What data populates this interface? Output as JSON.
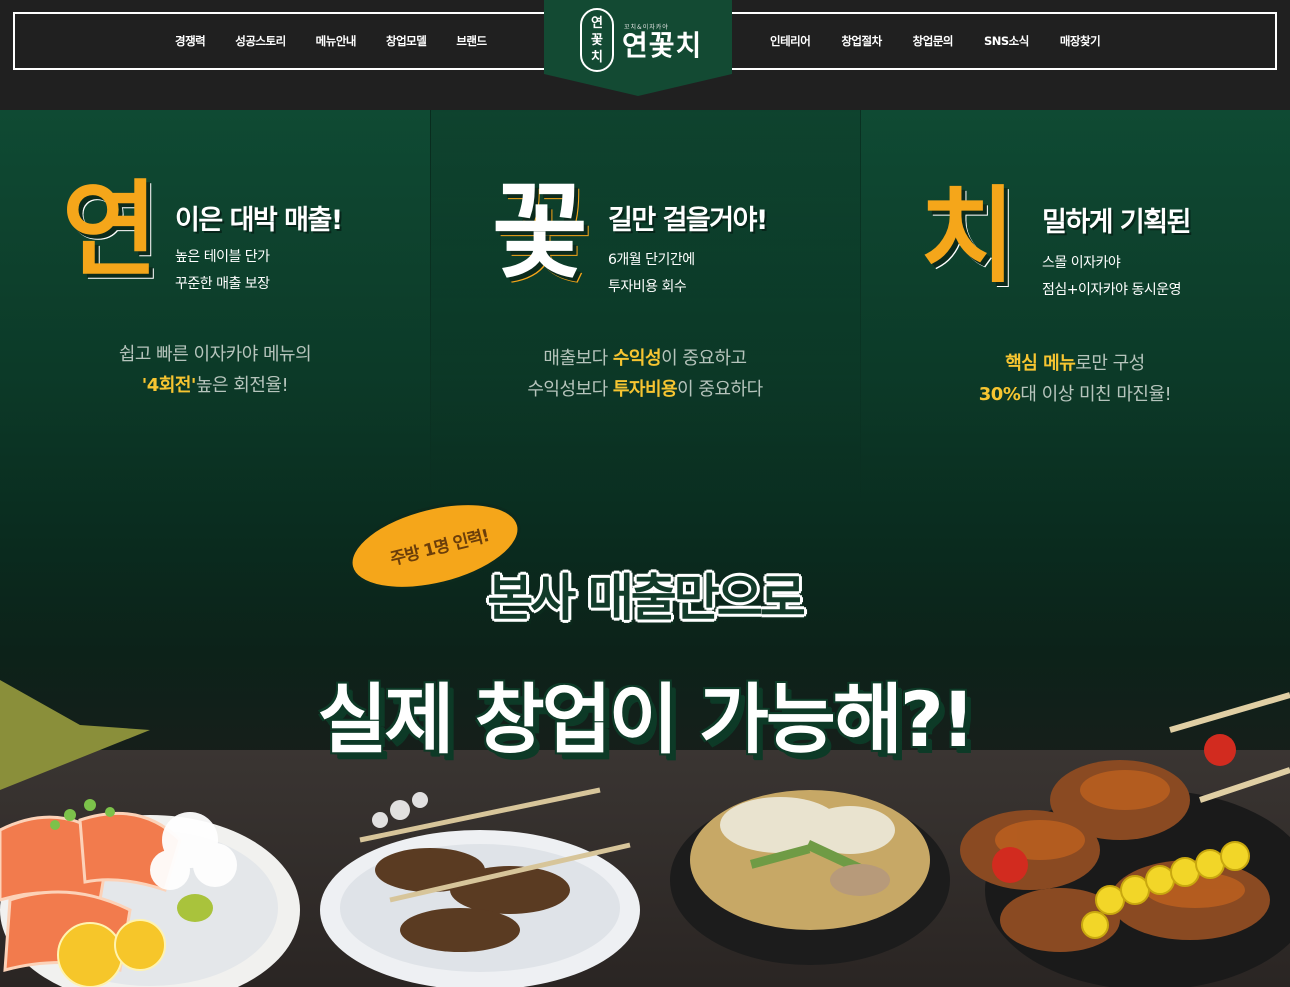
{
  "header": {
    "nav_left": [
      "경쟁력",
      "성공스토리",
      "메뉴안내",
      "창업모델",
      "브랜드"
    ],
    "nav_right": [
      "인테리어",
      "창업절차",
      "창업문의",
      "SNS소식",
      "매장찾기"
    ],
    "logo": {
      "mark": [
        "연",
        "꽃",
        "치"
      ],
      "subtitle": "꼬치&이자카야",
      "text": "연꽃치"
    }
  },
  "columns": [
    {
      "big_char": "연",
      "headline": "이은 대박 매출!",
      "sub": [
        "높은 테이블 단가",
        "꾸준한 매출 보장"
      ],
      "desc_line1": "쉽고 빠른 이자카야 메뉴의",
      "desc_line2_hl": "'4회전'",
      "desc_line2_rest": "높은 회전율!"
    },
    {
      "big_char": "꽃",
      "headline": "길만 걸을거야!",
      "sub": [
        "6개월 단기간에",
        "투자비용 회수"
      ],
      "desc_line1_a": "매출보다 ",
      "desc_line1_hl": "수익성",
      "desc_line1_b": "이 중요하고",
      "desc_line2_a": "수익성보다 ",
      "desc_line2_hl": "투자비용",
      "desc_line2_b": "이 중요하다"
    },
    {
      "big_char": "치",
      "headline": "밀하게 기획된",
      "sub": [
        "스몰 이자카야",
        "점심+이자카야 동시운영"
      ],
      "desc_line1_hl": "핵심 메뉴",
      "desc_line1_rest": "로만 구성",
      "desc_line2_hl": "30%",
      "desc_line2_rest": "대 이상 미친 마진율!"
    }
  ],
  "promo": {
    "badge": "주방 1명 인력!",
    "line1": "본사 매출만으로",
    "line2": "실제 창업이 가능해?!"
  },
  "colors": {
    "header_bg": "#202020",
    "brand_green": "#134a33",
    "accent_orange": "#f5a61a",
    "highlight_yellow": "#f7c531"
  }
}
